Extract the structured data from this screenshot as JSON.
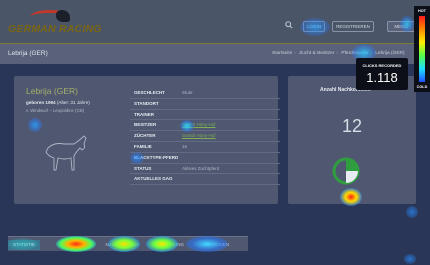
{
  "header": {
    "logo_text": "GERMAN RACING",
    "login_label": "LOGIN",
    "register_label": "REGISTRIEREN",
    "menu_label": "MENÜ"
  },
  "subheader": {
    "title": "Lebrija (GER)",
    "breadcrumb": [
      "Startseite",
      "Zucht & Besitzer",
      "Pferdesuche",
      "Lebrija (GER)"
    ]
  },
  "horse": {
    "name": "Lebrija (GER)",
    "born_label": "geboren 1994",
    "age": "(Alter: 31 Jahre)",
    "lineage": "v. Windwurf – Leopoldine (GB)"
  },
  "details": [
    {
      "label": "GESCHLECHT",
      "value": "Stute",
      "link": false
    },
    {
      "label": "STANDORT",
      "value": "",
      "link": false
    },
    {
      "label": "TRAINER",
      "value": "",
      "link": false
    },
    {
      "label": "BESITZER",
      "value": "Gestüt Höny-Hof",
      "link": true
    },
    {
      "label": "ZÜCHTER",
      "value": "Gestüt Höny-Hof",
      "link": true
    },
    {
      "label": "FAMILIE",
      "value": "16",
      "link": false
    },
    {
      "label": "BLACKTYPE-PFERD",
      "value": "",
      "link": false
    },
    {
      "label": "STATUS",
      "value": "Aktives Zuchtpferd",
      "link": false
    },
    {
      "label": "AKTUELLES GAG",
      "value": "",
      "link": false
    }
  ],
  "side": {
    "title": "Anzahl Nachkommen",
    "count": "12"
  },
  "tabs": [
    "STATISTIK",
    "RENNEN",
    "NACHKOMMEN",
    "ABSTAMMUNG",
    "AUKTIONEN"
  ],
  "clicks": {
    "label": "CLICKS RECORDED",
    "value": "1.118"
  },
  "legend": {
    "hot": "HOT",
    "cold": "COLD"
  },
  "colors": {
    "accent_green": "#7fae52",
    "pie_green": "#2e9e3e",
    "gold": "#7a6512"
  }
}
